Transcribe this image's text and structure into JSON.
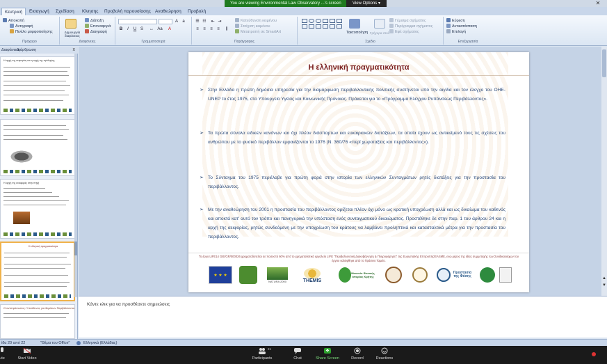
{
  "share": {
    "banner": "You are viewing Environmental Law Observatory ...'s screen",
    "view_options": "View Options ▾"
  },
  "ribbon": {
    "tabs": [
      "Κεντρική",
      "Εισαγωγή",
      "Σχεδίαση",
      "Κίνησης",
      "Προβολή παρουσίασης",
      "Αναθεώρηση",
      "Προβολή"
    ],
    "clipboard": {
      "items": [
        "Αποκοπή",
        "Αντιγραφή",
        "Πινέλο μορφοποίησης"
      ],
      "label": "Πρόχειρο"
    },
    "slides": {
      "new_slide": "Δημιουργία διαφάνειας",
      "items": [
        "Διάταξη",
        "Επαναφορά",
        "Διαγραφή"
      ],
      "label": "Διαφάνειες"
    },
    "font": {
      "label": "Γραμματοσειρά"
    },
    "paragraph": {
      "items": [
        "Κατεύθυνση κειμένου",
        "Στοίχιση κειμένου",
        "Μετατροπή σε SmartArt"
      ],
      "label": "Παράγραφος"
    },
    "drawing": {
      "arrange": "Τακτοποίηση",
      "quick_styles": "Γρήγορα στυλ",
      "items": [
        "Γέμισμα σχήματος",
        "Περίγραμμα σχήματος",
        "Εφέ σχήματος"
      ],
      "label": "Σχέδιο"
    },
    "editing": {
      "items": [
        "Εύρεση",
        "Αντικατάσταση",
        "Επιλογή"
      ],
      "label": "Επεξεργασία"
    }
  },
  "panel": {
    "tabs": [
      "Διαφάνειες",
      "Διάρθρωση"
    ],
    "close": "x",
    "thumbs": [
      "Η αρχή της αειφορίας και η αρχή της πρόληψης",
      "",
      "Η αρχή της αναφοράς στην πηγή",
      "Η ελληνική πραγματικότητα",
      "Ο αντιπρόσωπος: Υπεύθυνος για θεμάτων Περιβάλλοντος"
    ]
  },
  "slide": {
    "title": "Η ελληνική πραγματικότητα",
    "bullets": [
      "Στην Ελλάδα η πρώτη δημόσια υπηρεσία για την διαμόρφωση περιβαλλοντικής πολιτικής συστήνεται υπό την αιγίδα και τον έλεγχο του OHE-UNEP το έτος 1975, στο Υπουργείο Υγείας και Κοινωνικής Πρόνοιας. Πρόκειται για το «Πρόγραμμα Ελέγχου Ρυπάνσεως Περιβάλλοντος».",
      "Τα πρώτα σύνολα ειδικών κανόνων και όχι πλέον διάσπαρτων και ευκαιριακών διατάξεων, τα οποία έχουν ως αντικείμενό τους τις σχέσεις του ανθρώπου με το φυσικό περιβάλλον εμφανίζονται το 1976 (Ν. 360/76 «περί χωροταξίας και περιβάλλοντος»).",
      "Το Σύνταγμα του 1975 περιέλαβε για πρώτη φορά στην ιστορία των ελληνικών Συνταγμάτων ρητές διατάξεις για την προστασία του περιβάλλοντος.",
      "Με την αναθεώρηση του 2001 η προστασία του περιβάλλοντος ορίζεται πλέον όχι μόνο ως κρατική υποχρέωση αλλά και ως δικαίωμα του καθενός και αποκτά κατ' αυτό τον τρόπο και πανηγυρικά την υπόσταση ενός συνταγματικού δικαιώματος. Προστέθηκε δε στην παρ. 1 του άρθρου 24 και η αρχή της αειφορίας, ρητώς συνδεόμενη με την υποχρέωση του κράτους να λαμβάνει προληπτικά και κατασταλτικά μέτρα για την προστασία του περιβάλλοντος."
    ],
    "footer": "Το έργο LIFE14 GIE/GR/000026 χρηματοδοτείται σε ποσοστό 60% από το χρηματοδοτικό εργαλείο LIFE \"Περιβαλλοντική Διακυβέρνηση & Πληροφόρηση\" της Ευρωπαϊκής Επιτροπής/EASME, ενώ μέρος της ιδίας συμμετοχής των Συνδικαιούχων του έργου καλύφθηκε από το Πράσινο Ταμείο.",
    "logos": [
      "NATURA 2000",
      "THEMIS",
      "Μουσείο Φυσικής Ιστορίας Κρήτης",
      "Προστασία της Φύσης"
    ]
  },
  "notes": {
    "placeholder": "Κάντε κλικ για να προσθέσετε σημειώσεις"
  },
  "status": {
    "slide": "ίδα 20 από 22",
    "theme": "\"Θέμα του Office\"",
    "language": "Ελληνικά (Ελλάδας)"
  },
  "meeting": {
    "controls": [
      "ute",
      "Start Video",
      "Participants",
      "Chat",
      "Share Screen",
      "Record",
      "Reactions"
    ],
    "participants_count": "21"
  }
}
